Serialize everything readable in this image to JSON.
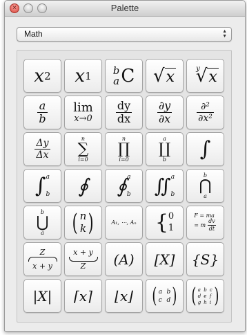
{
  "window": {
    "title": "Palette"
  },
  "category_select": {
    "value": "Math"
  },
  "palette": {
    "b01": {
      "base": "x",
      "sup": "2"
    },
    "b02": {
      "base": "x",
      "sub": "1"
    },
    "b03": {
      "top": "b",
      "bottom": "a",
      "main": "C"
    },
    "b04": {
      "rad": "√",
      "arg": "x"
    },
    "b05": {
      "idx": "y",
      "rad": "√",
      "arg": "x"
    },
    "b06": {
      "num": "a",
      "den": "b"
    },
    "b07": {
      "op": "lim",
      "under": "x→0"
    },
    "b08": {
      "num": "dy",
      "den": "dx"
    },
    "b09": {
      "num": "∂y",
      "den": "∂x"
    },
    "b10": {
      "num": "∂²",
      "den": "∂x²"
    },
    "b11": {
      "num": "Δy",
      "den": "Δx"
    },
    "b12": {
      "top": "n",
      "op": "∑",
      "bottom": "i=0"
    },
    "b13": {
      "top": "n",
      "op": "∏",
      "bottom": "i=0"
    },
    "b14": {
      "top": "a",
      "op": "∐",
      "bottom": "b"
    },
    "b15": {
      "op": "∫"
    },
    "b16": {
      "op": "∫",
      "sup": "a",
      "sub": "b"
    },
    "b17": {
      "op": "∮"
    },
    "b18": {
      "op": "∮",
      "sup": "a",
      "sub": "b"
    },
    "b19": {
      "op": "∬",
      "sup": "a",
      "sub": "b"
    },
    "b20": {
      "top": "b",
      "op": "⋂",
      "bottom": "a"
    },
    "b21": {
      "top": "b",
      "op": "⋃",
      "bottom": "a"
    },
    "b22": {
      "left": "(",
      "top": "n",
      "bottom": "k",
      "right": ")"
    },
    "b23": {
      "text": "A₁, ⋯, Aₙ"
    },
    "b24": {
      "brace": "{",
      "top": "0",
      "bottom": "1"
    },
    "b25": {
      "line1": "F = ma",
      "line2a": "= m",
      "num": "dv",
      "den": "dt"
    },
    "b26": {
      "top": "Z",
      "bottom": "x + y"
    },
    "b27": {
      "top": "x + y",
      "bottom": "Z"
    },
    "b28": {
      "text": "(A)"
    },
    "b29": {
      "text": "[X]"
    },
    "b30": {
      "text": "{S}"
    },
    "b31": {
      "text": "|X|"
    },
    "b32": {
      "text": "⌈x⌉"
    },
    "b33": {
      "text": "⌊x⌋"
    },
    "b34": {
      "a": "a",
      "b": "b",
      "c": "c",
      "d": "d"
    },
    "b35": {
      "cells": [
        "a",
        "b",
        "c",
        "d",
        "e",
        "f",
        "g",
        "h",
        "i"
      ]
    }
  }
}
